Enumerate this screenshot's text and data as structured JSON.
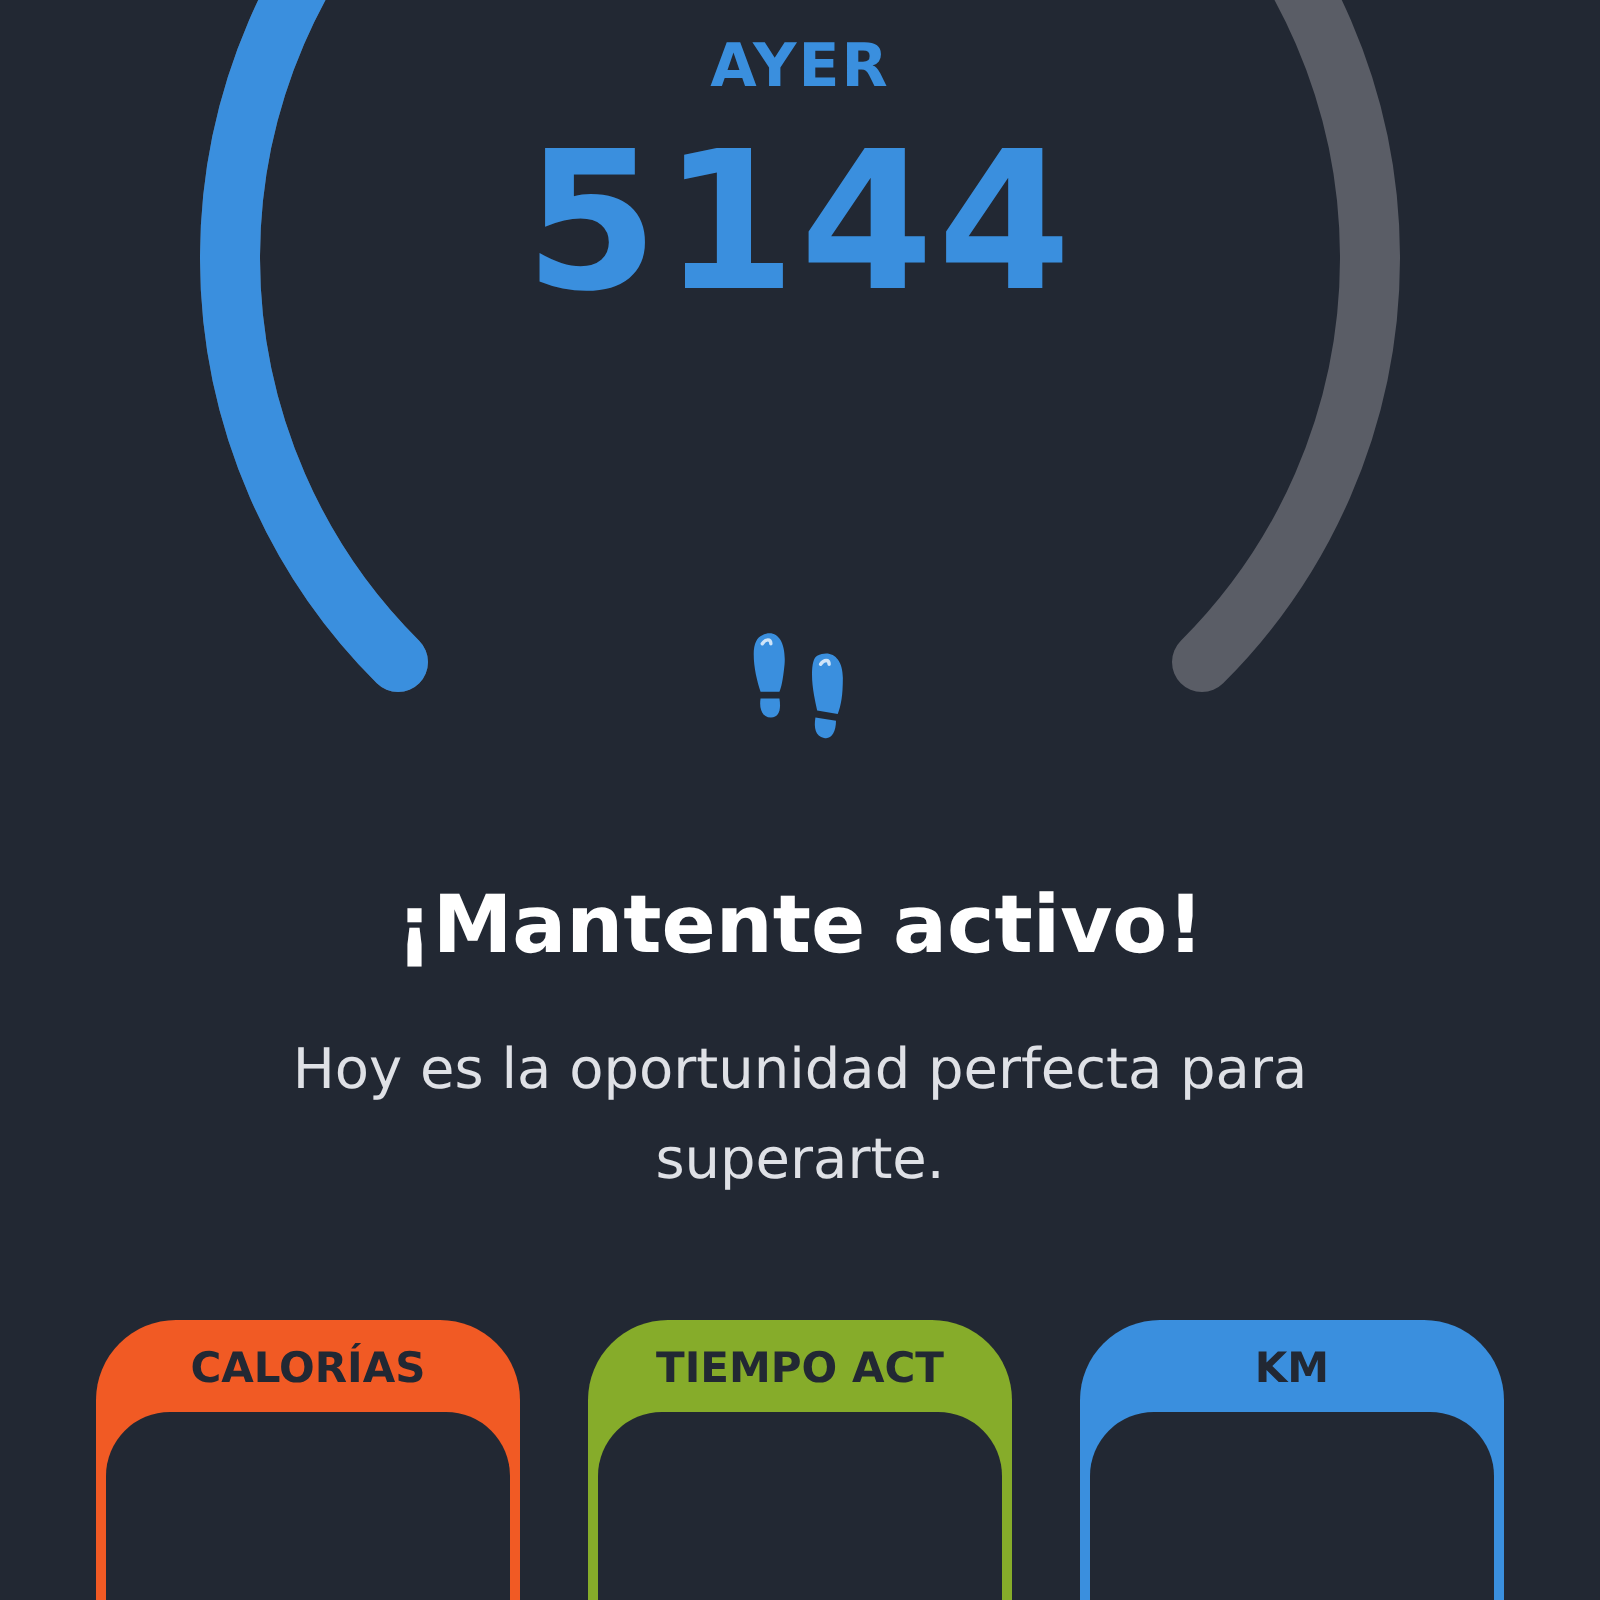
{
  "gauge": {
    "label": "AYER",
    "value": "5144"
  },
  "message": {
    "title": "¡Mantente activo!",
    "text": "Hoy es la oportunidad perfecta para superarte."
  },
  "cards": [
    {
      "label": "CALORÍAS",
      "color": "#f15a24"
    },
    {
      "label": "TIEMPO ACT",
      "color": "#86ac2a"
    },
    {
      "label": "KM",
      "color": "#3a8fde"
    }
  ]
}
